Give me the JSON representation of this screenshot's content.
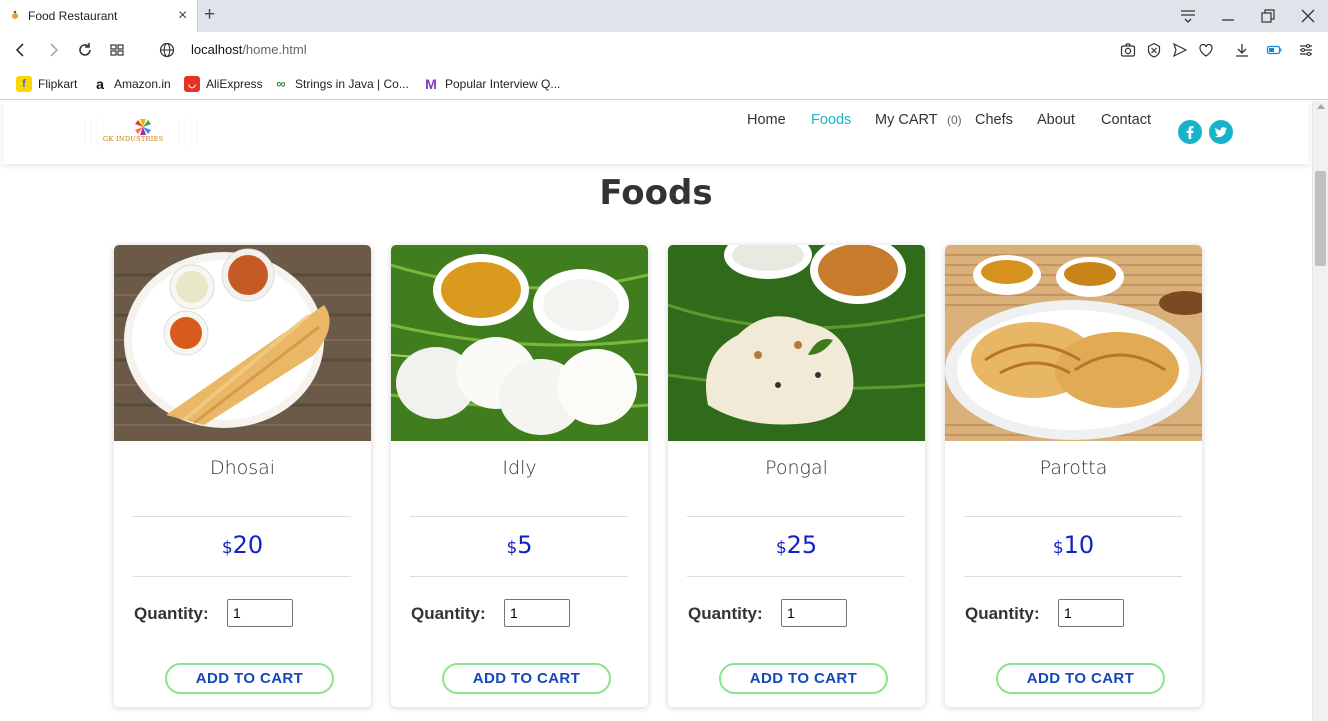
{
  "browser": {
    "tab_title": "Food Restaurant",
    "url_host": "localhost",
    "url_path": "/home.html",
    "bookmarks": [
      {
        "label": "Flipkart",
        "icon": "flipkart-icon"
      },
      {
        "label": "Amazon.in",
        "icon": "amazon-icon"
      },
      {
        "label": "AliExpress",
        "icon": "aliexpress-icon"
      },
      {
        "label": "Strings in Java | Co...",
        "icon": "geeksforgeeks-icon"
      },
      {
        "label": "Popular Interview Q...",
        "icon": "m-logo-icon"
      }
    ]
  },
  "site": {
    "logo_text": "GK INDUSTRIES",
    "nav": {
      "home": "Home",
      "foods": "Foods",
      "cart": "My CART",
      "cart_count": "(0)",
      "chefs": "Chefs",
      "about": "About",
      "contact": "Contact"
    },
    "accent_color": "#17b3c8",
    "price_color": "#1322c8",
    "button_border_color": "#8be38b"
  },
  "page": {
    "heading": "Foods"
  },
  "foods": [
    {
      "name": "Dhosai",
      "currency": "$",
      "price": "20",
      "quantity_label": "Quantity:",
      "quantity": "1",
      "button": "ADD TO CART"
    },
    {
      "name": "Idly",
      "currency": "$",
      "price": "5",
      "quantity_label": "Quantity:",
      "quantity": "1",
      "button": "ADD TO CART"
    },
    {
      "name": "Pongal",
      "currency": "$",
      "price": "25",
      "quantity_label": "Quantity:",
      "quantity": "1",
      "button": "ADD TO CART"
    },
    {
      "name": "Parotta",
      "currency": "$",
      "price": "10",
      "quantity_label": "Quantity:",
      "quantity": "1",
      "button": "ADD TO CART"
    }
  ]
}
